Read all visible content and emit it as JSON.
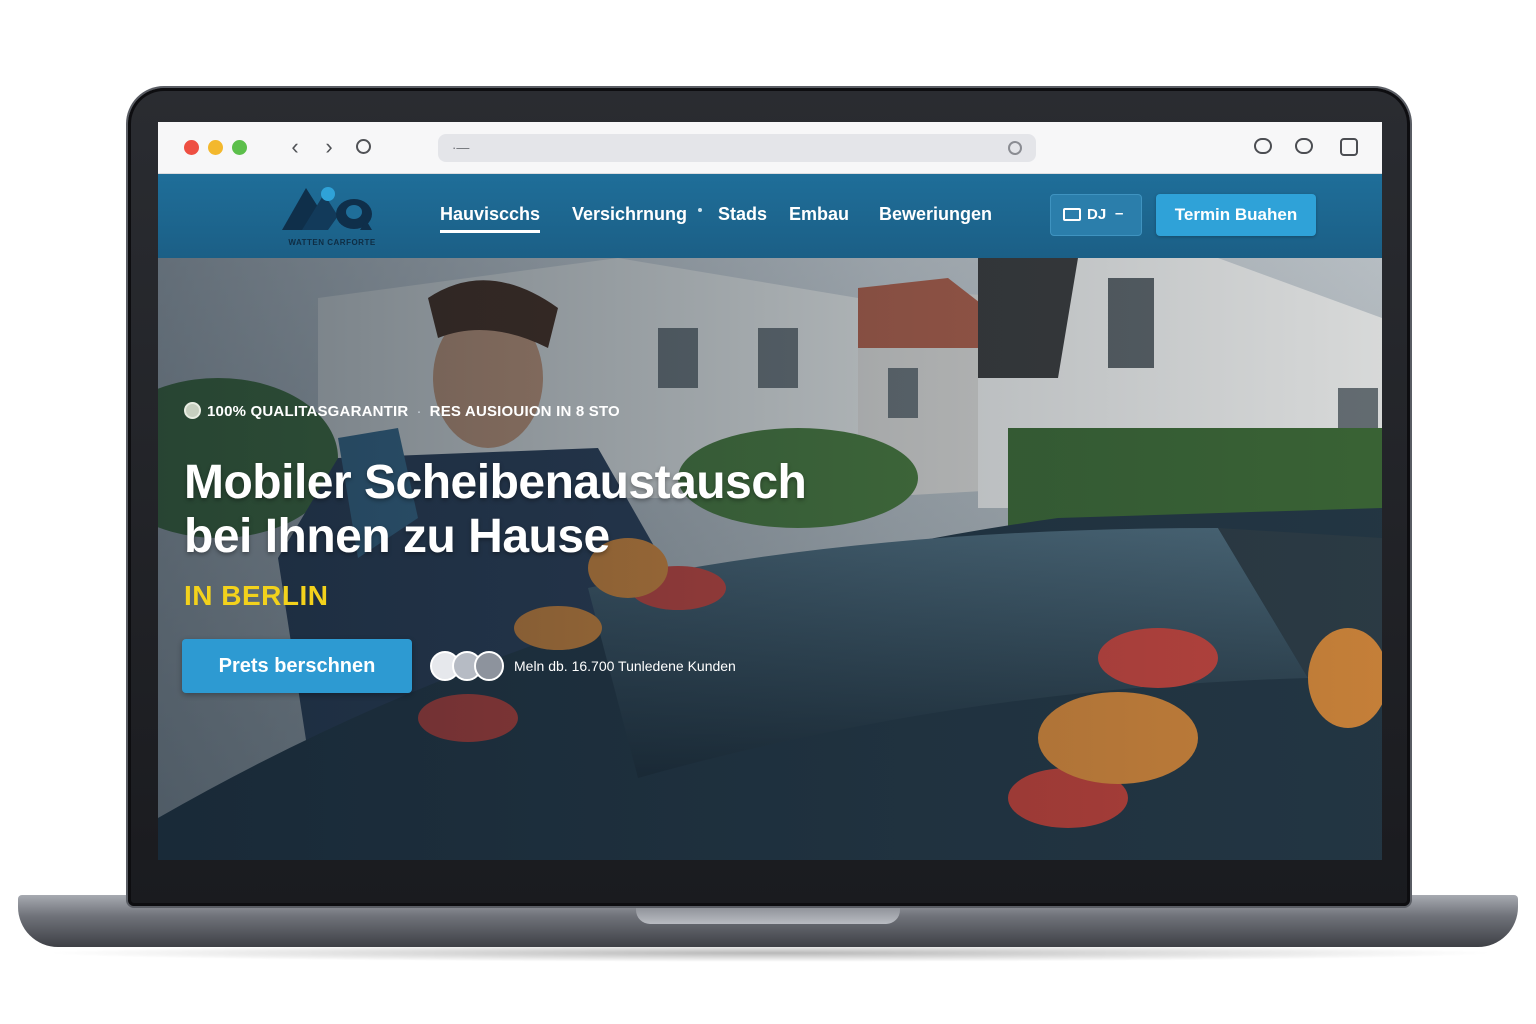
{
  "browser": {
    "address_text": "·—",
    "nav_back": "‹",
    "nav_forward": "›"
  },
  "site": {
    "logo_tagline": "WATTEN CARFORTE",
    "nav": [
      {
        "label": "Hauviscchs",
        "active": true
      },
      {
        "label": "Versichrnung",
        "active": false
      },
      {
        "label": "Stads",
        "active": false
      },
      {
        "label": "Embau",
        "active": false
      },
      {
        "label": "Beweriungen",
        "active": false
      }
    ],
    "language_label": "DJ",
    "language_dash": "–",
    "cta_label": "Termin Buahen"
  },
  "hero": {
    "badge_1": "100% QUALITASGARANTIR",
    "badge_sep": "·",
    "badge_2": "RES AUSIOUION IN 8 STO",
    "title_line_1": "Mobiler Scheibenaustausch",
    "title_line_2": "bei Ihnen zu Hause",
    "city": "IN BERLIN",
    "cta_label": "Prets berschnen",
    "social_proof": "Meln db. 16.700 Tunledene Kunden"
  },
  "colors": {
    "header_bg": "#1f6e99",
    "cta_blue": "#2fa2d8",
    "city_yellow": "#f3d21c"
  }
}
